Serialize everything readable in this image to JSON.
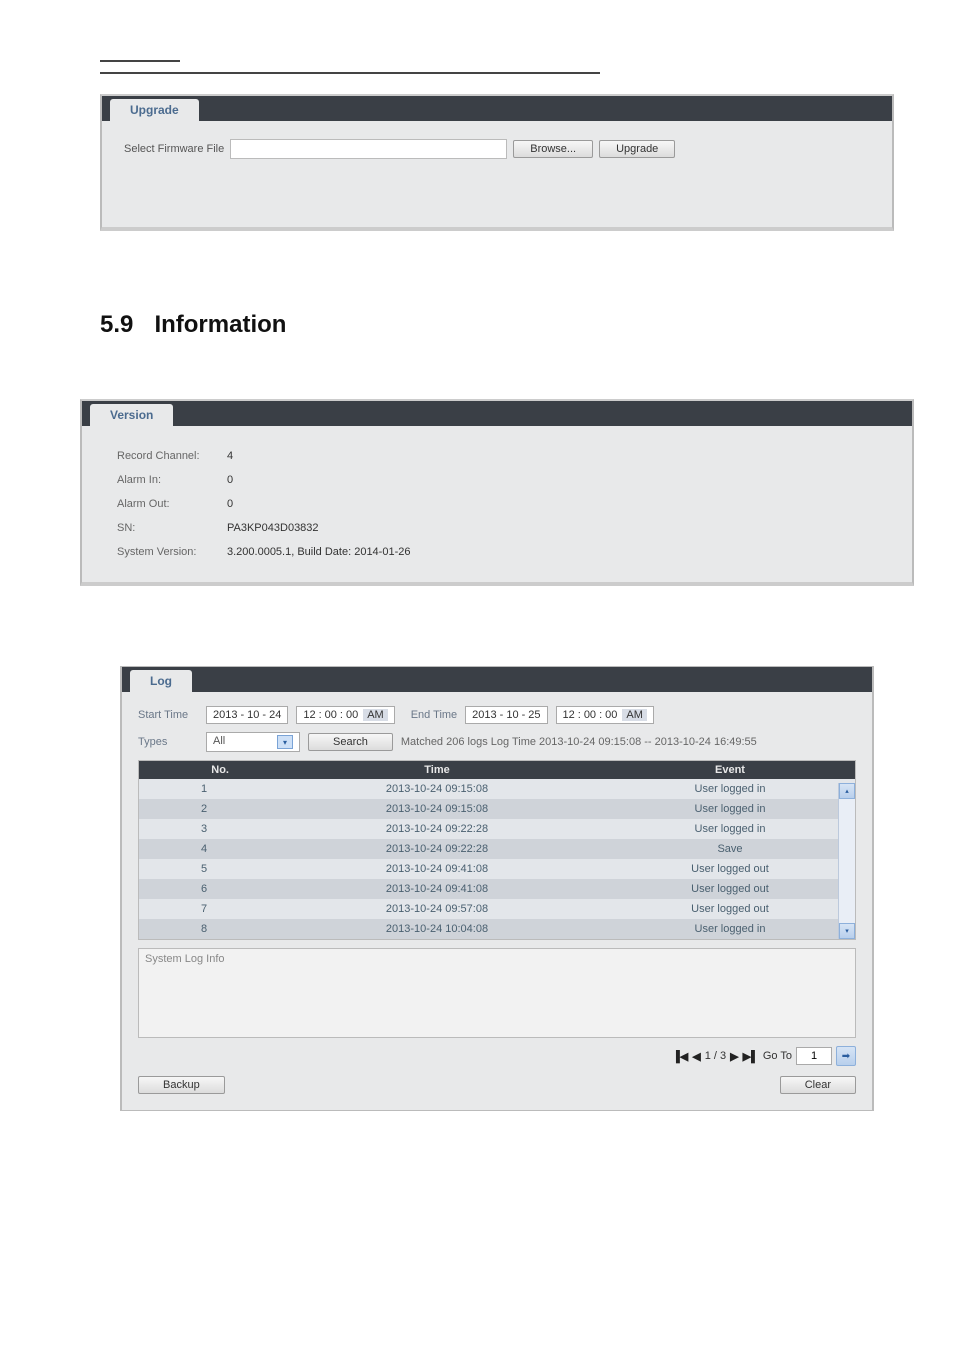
{
  "upgrade_panel": {
    "title": "Upgrade",
    "file_label": "Select Firmware File",
    "browse_btn": "Browse...",
    "upgrade_btn": "Upgrade"
  },
  "section": {
    "number": "5.9",
    "title": "Information"
  },
  "version_panel": {
    "title": "Version",
    "rows": [
      {
        "key": "Record Channel:",
        "val": "4"
      },
      {
        "key": "Alarm In:",
        "val": "0"
      },
      {
        "key": "Alarm Out:",
        "val": "0"
      },
      {
        "key": "SN:",
        "val": "PA3KP043D03832"
      },
      {
        "key": "System Version:",
        "val": "3.200.0005.1, Build Date: 2014-01-26"
      }
    ]
  },
  "log_panel": {
    "title": "Log",
    "start_label": "Start Time",
    "end_label": "End Time",
    "types_label": "Types",
    "types_value": "All",
    "search_btn": "Search",
    "matched_text": "Matched  206 logs   Log Time 2013-10-24 09:15:08 -- 2013-10-24 16:49:55",
    "start_date": {
      "y": "2013",
      "m": "10",
      "d": "24"
    },
    "start_time": {
      "h": "12",
      "mi": "00",
      "s": "00",
      "ap": "AM"
    },
    "end_date": {
      "y": "2013",
      "m": "10",
      "d": "25"
    },
    "end_time": {
      "h": "12",
      "mi": "00",
      "s": "00",
      "ap": "AM"
    },
    "columns": {
      "no": "No.",
      "time": "Time",
      "event": "Event"
    },
    "rows": [
      {
        "no": "1",
        "time": "2013-10-24 09:15:08",
        "event": "User logged in"
      },
      {
        "no": "2",
        "time": "2013-10-24 09:15:08",
        "event": "User logged in"
      },
      {
        "no": "3",
        "time": "2013-10-24 09:22:28",
        "event": "User logged in"
      },
      {
        "no": "4",
        "time": "2013-10-24 09:22:28",
        "event": "Save"
      },
      {
        "no": "5",
        "time": "2013-10-24 09:41:08",
        "event": "User logged out"
      },
      {
        "no": "6",
        "time": "2013-10-24 09:41:08",
        "event": "User logged out"
      },
      {
        "no": "7",
        "time": "2013-10-24 09:57:08",
        "event": "User logged out"
      },
      {
        "no": "8",
        "time": "2013-10-24 10:04:08",
        "event": "User logged in"
      }
    ],
    "sys_log_label": "System Log Info",
    "pager": {
      "page_text": "1 / 3",
      "goto_label": "Go To",
      "goto_value": "1"
    },
    "backup_btn": "Backup",
    "clear_btn": "Clear"
  }
}
